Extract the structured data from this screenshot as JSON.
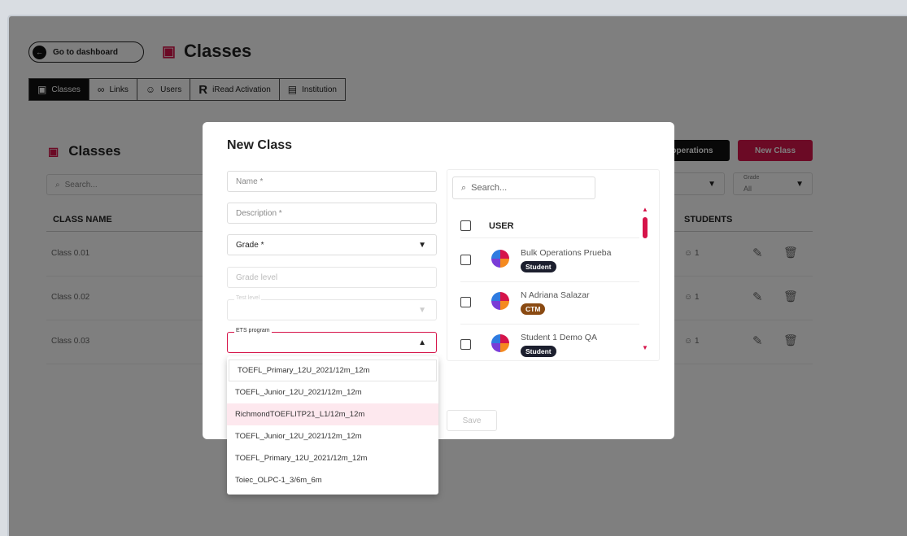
{
  "header": {
    "go_dashboard": "Go to dashboard",
    "title": "Classes"
  },
  "tabs": [
    {
      "label": "Classes",
      "icon": "clipboard-icon",
      "active": true
    },
    {
      "label": "Links",
      "icon": "link-icon",
      "active": false
    },
    {
      "label": "Users",
      "icon": "users-icon",
      "active": false
    },
    {
      "label": "iRead Activation",
      "icon": "iread-icon",
      "active": false
    },
    {
      "label": "Institution",
      "icon": "institution-icon",
      "active": false
    }
  ],
  "card": {
    "title": "Classes",
    "search_placeholder": "Search...",
    "operations_label": "operations",
    "new_class_label": "New Class",
    "grade_filter": {
      "label": "Grade",
      "value": "All"
    },
    "columns": {
      "class_name": "CLASS NAME",
      "students": "STUDENTS"
    },
    "rows": [
      {
        "name": "Class 0.01",
        "students": "1"
      },
      {
        "name": "Class 0.02",
        "students": "1"
      },
      {
        "name": "Class 0.03",
        "students": "1"
      }
    ]
  },
  "modal": {
    "title": "New Class",
    "name_placeholder": "Name *",
    "description_placeholder": "Description *",
    "grade_label": "Grade *",
    "grade_level_placeholder": "Grade level",
    "test_level_label": "Test level",
    "ets_program_label": "ETS program",
    "save_label": "Save",
    "user_search_placeholder": "Search...",
    "user_column": "USER",
    "users": [
      {
        "name": "Bulk Operations Prueba",
        "role": "Student"
      },
      {
        "name": "N Adriana Salazar",
        "role": "CTM"
      },
      {
        "name": "Student 1 Demo QA",
        "role": "Student"
      }
    ],
    "ets_options": [
      "TOEFL_Primary_12U_2021/12m_12m",
      "TOEFL_Junior_12U_2021/12m_12m",
      "RichmondTOEFLITP21_L1/12m_12m",
      "TOEFL_Junior_12U_2021/12m_12m",
      "TOEFL_Primary_12U_2021/12m_12m",
      "Toiec_OLPC-1_3/6m_6m"
    ]
  },
  "colors": {
    "accent": "#d6144a",
    "dark": "#111111"
  }
}
